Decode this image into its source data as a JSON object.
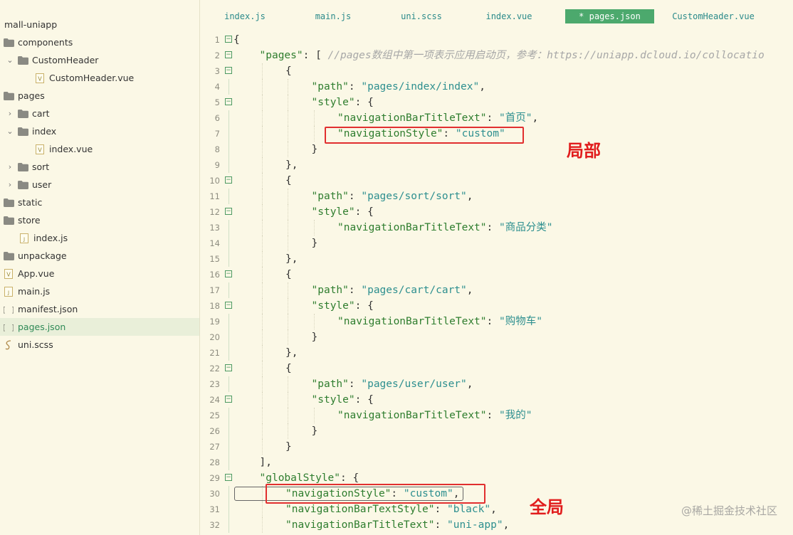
{
  "sidebar": {
    "project_title": "mall-uniapp",
    "items": [
      {
        "label": "components",
        "type": "folder",
        "depth": 0,
        "arrow": ""
      },
      {
        "label": "CustomHeader",
        "type": "folder",
        "depth": 1,
        "arrow": "⌄"
      },
      {
        "label": "CustomHeader.vue",
        "type": "vue",
        "depth": 2,
        "arrow": ""
      },
      {
        "label": "pages",
        "type": "folder",
        "depth": 0,
        "arrow": ""
      },
      {
        "label": "cart",
        "type": "folder",
        "depth": 1,
        "arrow": "›"
      },
      {
        "label": "index",
        "type": "folder",
        "depth": 1,
        "arrow": "⌄"
      },
      {
        "label": "index.vue",
        "type": "vue",
        "depth": 2,
        "arrow": ""
      },
      {
        "label": "sort",
        "type": "folder",
        "depth": 1,
        "arrow": "›"
      },
      {
        "label": "user",
        "type": "folder",
        "depth": 1,
        "arrow": "›"
      },
      {
        "label": "static",
        "type": "folder",
        "depth": 0,
        "arrow": ""
      },
      {
        "label": "store",
        "type": "folder",
        "depth": 0,
        "arrow": ""
      },
      {
        "label": "index.js",
        "type": "js",
        "depth": 1,
        "arrow": ""
      },
      {
        "label": "unpackage",
        "type": "folder",
        "depth": 0,
        "arrow": ""
      },
      {
        "label": "App.vue",
        "type": "vue",
        "depth": 0,
        "arrow": ""
      },
      {
        "label": "main.js",
        "type": "js",
        "depth": 0,
        "arrow": ""
      },
      {
        "label": "manifest.json",
        "type": "json",
        "depth": 0,
        "arrow": ""
      },
      {
        "label": "pages.json",
        "type": "json",
        "depth": 0,
        "arrow": "",
        "selected": true
      },
      {
        "label": "uni.scss",
        "type": "scss",
        "depth": 0,
        "arrow": ""
      }
    ]
  },
  "tabs": [
    {
      "label": "index.js"
    },
    {
      "label": "main.js"
    },
    {
      "label": "uni.scss"
    },
    {
      "label": "index.vue"
    },
    {
      "label": "* pages.json",
      "active": true
    },
    {
      "label": "CustomHeader.vue"
    }
  ],
  "editor": {
    "lines": [
      {
        "n": "1",
        "fold": true,
        "indent": 0,
        "tokens": [
          [
            "{",
            "punc"
          ]
        ]
      },
      {
        "n": "2",
        "fold": true,
        "indent": 1,
        "tokens": [
          [
            "\"pages\"",
            "key"
          ],
          [
            ": [ ",
            "punc"
          ],
          [
            "//pages数组中第一项表示应用启动页，参考：https://uniapp.dcloud.io/collocatio",
            "com"
          ]
        ]
      },
      {
        "n": "3",
        "fold": true,
        "indent": 2,
        "tokens": [
          [
            "{",
            "punc"
          ]
        ]
      },
      {
        "n": "4",
        "fold": false,
        "indent": 3,
        "tokens": [
          [
            "\"path\"",
            "key"
          ],
          [
            ": ",
            "punc"
          ],
          [
            "\"pages/index/index\"",
            "str"
          ],
          [
            ",",
            "punc"
          ]
        ]
      },
      {
        "n": "5",
        "fold": true,
        "indent": 3,
        "tokens": [
          [
            "\"style\"",
            "key"
          ],
          [
            ": {",
            "punc"
          ]
        ]
      },
      {
        "n": "6",
        "fold": false,
        "indent": 4,
        "tokens": [
          [
            "\"navigationBarTitleText\"",
            "key"
          ],
          [
            ": ",
            "punc"
          ],
          [
            "\"首页\"",
            "str"
          ],
          [
            ",",
            "punc"
          ]
        ]
      },
      {
        "n": "7",
        "fold": false,
        "indent": 4,
        "tokens": [
          [
            "\"navigationStyle\"",
            "key"
          ],
          [
            ": ",
            "punc"
          ],
          [
            "\"custom\"",
            "str"
          ]
        ]
      },
      {
        "n": "8",
        "fold": false,
        "indent": 3,
        "tokens": [
          [
            "}",
            "punc"
          ]
        ]
      },
      {
        "n": "9",
        "fold": false,
        "indent": 2,
        "tokens": [
          [
            "},",
            "punc"
          ]
        ]
      },
      {
        "n": "10",
        "fold": true,
        "indent": 2,
        "tokens": [
          [
            "{",
            "punc"
          ]
        ]
      },
      {
        "n": "11",
        "fold": false,
        "indent": 3,
        "tokens": [
          [
            "\"path\"",
            "key"
          ],
          [
            ": ",
            "punc"
          ],
          [
            "\"pages/sort/sort\"",
            "str"
          ],
          [
            ",",
            "punc"
          ]
        ]
      },
      {
        "n": "12",
        "fold": true,
        "indent": 3,
        "tokens": [
          [
            "\"style\"",
            "key"
          ],
          [
            ": {",
            "punc"
          ]
        ]
      },
      {
        "n": "13",
        "fold": false,
        "indent": 4,
        "tokens": [
          [
            "\"navigationBarTitleText\"",
            "key"
          ],
          [
            ": ",
            "punc"
          ],
          [
            "\"商品分类\"",
            "str"
          ]
        ]
      },
      {
        "n": "14",
        "fold": false,
        "indent": 3,
        "tokens": [
          [
            "}",
            "punc"
          ]
        ]
      },
      {
        "n": "15",
        "fold": false,
        "indent": 2,
        "tokens": [
          [
            "},",
            "punc"
          ]
        ]
      },
      {
        "n": "16",
        "fold": true,
        "indent": 2,
        "tokens": [
          [
            "{",
            "punc"
          ]
        ]
      },
      {
        "n": "17",
        "fold": false,
        "indent": 3,
        "tokens": [
          [
            "\"path\"",
            "key"
          ],
          [
            ": ",
            "punc"
          ],
          [
            "\"pages/cart/cart\"",
            "str"
          ],
          [
            ",",
            "punc"
          ]
        ]
      },
      {
        "n": "18",
        "fold": true,
        "indent": 3,
        "tokens": [
          [
            "\"style\"",
            "key"
          ],
          [
            ": {",
            "punc"
          ]
        ]
      },
      {
        "n": "19",
        "fold": false,
        "indent": 4,
        "tokens": [
          [
            "\"navigationBarTitleText\"",
            "key"
          ],
          [
            ": ",
            "punc"
          ],
          [
            "\"购物车\"",
            "str"
          ]
        ]
      },
      {
        "n": "20",
        "fold": false,
        "indent": 3,
        "tokens": [
          [
            "}",
            "punc"
          ]
        ]
      },
      {
        "n": "21",
        "fold": false,
        "indent": 2,
        "tokens": [
          [
            "},",
            "punc"
          ]
        ]
      },
      {
        "n": "22",
        "fold": true,
        "indent": 2,
        "tokens": [
          [
            "{",
            "punc"
          ]
        ]
      },
      {
        "n": "23",
        "fold": false,
        "indent": 3,
        "tokens": [
          [
            "\"path\"",
            "key"
          ],
          [
            ": ",
            "punc"
          ],
          [
            "\"pages/user/user\"",
            "str"
          ],
          [
            ",",
            "punc"
          ]
        ]
      },
      {
        "n": "24",
        "fold": true,
        "indent": 3,
        "tokens": [
          [
            "\"style\"",
            "key"
          ],
          [
            ": {",
            "punc"
          ]
        ]
      },
      {
        "n": "25",
        "fold": false,
        "indent": 4,
        "tokens": [
          [
            "\"navigationBarTitleText\"",
            "key"
          ],
          [
            ": ",
            "punc"
          ],
          [
            "\"我的\"",
            "str"
          ]
        ]
      },
      {
        "n": "26",
        "fold": false,
        "indent": 3,
        "tokens": [
          [
            "}",
            "punc"
          ]
        ]
      },
      {
        "n": "27",
        "fold": false,
        "indent": 2,
        "tokens": [
          [
            "}",
            "punc"
          ]
        ]
      },
      {
        "n": "28",
        "fold": false,
        "indent": 1,
        "tokens": [
          [
            "],",
            "punc"
          ]
        ]
      },
      {
        "n": "29",
        "fold": true,
        "indent": 1,
        "tokens": [
          [
            "\"globalStyle\"",
            "key"
          ],
          [
            ": {",
            "punc"
          ]
        ]
      },
      {
        "n": "30",
        "fold": false,
        "indent": 2,
        "tokens": [
          [
            "\"navigationStyle\"",
            "key"
          ],
          [
            ": ",
            "punc"
          ],
          [
            "\"custom\"",
            "str"
          ],
          [
            ",",
            "punc"
          ]
        ],
        "current": true
      },
      {
        "n": "31",
        "fold": false,
        "indent": 2,
        "tokens": [
          [
            "\"navigationBarTextStyle\"",
            "key"
          ],
          [
            ": ",
            "punc"
          ],
          [
            "\"black\"",
            "str"
          ],
          [
            ",",
            "punc"
          ]
        ]
      },
      {
        "n": "32",
        "fold": false,
        "indent": 2,
        "tokens": [
          [
            "\"navigationBarTitleText\"",
            "key"
          ],
          [
            ": ",
            "punc"
          ],
          [
            "\"uni-app\"",
            "str"
          ],
          [
            ",",
            "punc"
          ]
        ]
      }
    ]
  },
  "annotations": {
    "local_label": "局部",
    "global_label": "全局"
  },
  "watermark": "@稀土掘金技术社区",
  "colors": {
    "background": "#fbf8e6",
    "accent": "#4ca96d",
    "annotation": "#e12f2f",
    "key": "#2e7d2e",
    "string": "#2d8f8f"
  }
}
